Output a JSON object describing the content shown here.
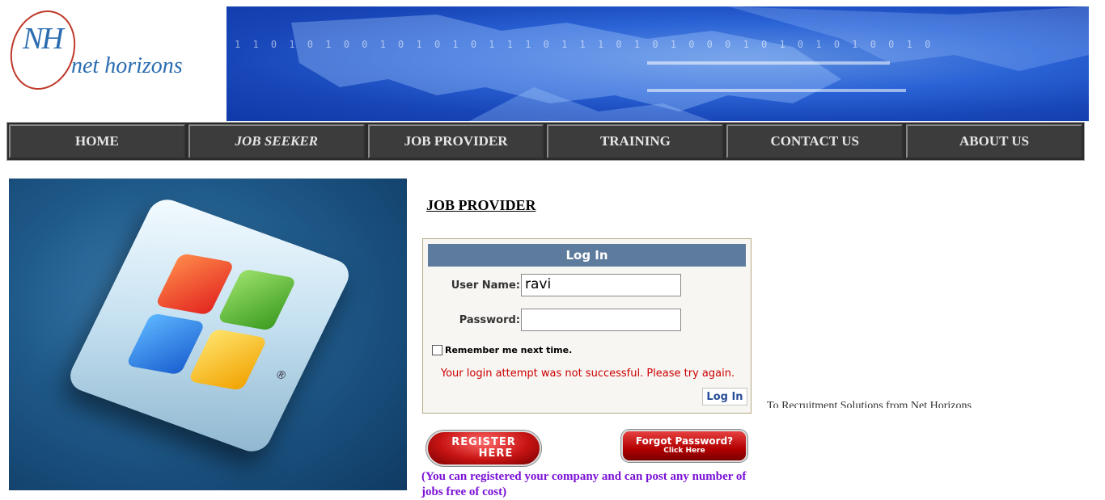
{
  "header": {
    "logo_mark": "NH",
    "logo_text": "net horizons",
    "banner_bits": "1 1 0 1 0 1 0 0 1 0 1 0 1 0 1 1 1 0 1 1 1 0 1 0 1 0 0 0 1 0 1 0 1 0 1 0 0 1 0"
  },
  "nav": {
    "items": [
      {
        "label": "HOME"
      },
      {
        "label": "JOB SEEKER"
      },
      {
        "label": "JOB PROVIDER"
      },
      {
        "label": "TRAINING"
      },
      {
        "label": "CONTACT US"
      },
      {
        "label": "ABOUT US"
      }
    ]
  },
  "hero": {
    "registered_mark": "®"
  },
  "page": {
    "title": "JOB PROVIDER"
  },
  "login": {
    "heading": "Log In",
    "username_label": "User Name:",
    "username_value": "ravi",
    "password_label": "Password:",
    "password_value": "",
    "remember_label": "Remember me next time.",
    "error_message": "Your login attempt was not successful. Please try again.",
    "submit_label": "Log In"
  },
  "actions": {
    "register_line1": "REGISTER",
    "register_line2": "HERE",
    "forgot_line1": "Forgot Password?",
    "forgot_line2": "Click Here"
  },
  "note": "(You can registered your company and can post any number of jobs free of cost)",
  "sidebar_text": "To Recruitment Solutions from Net Horizons"
}
